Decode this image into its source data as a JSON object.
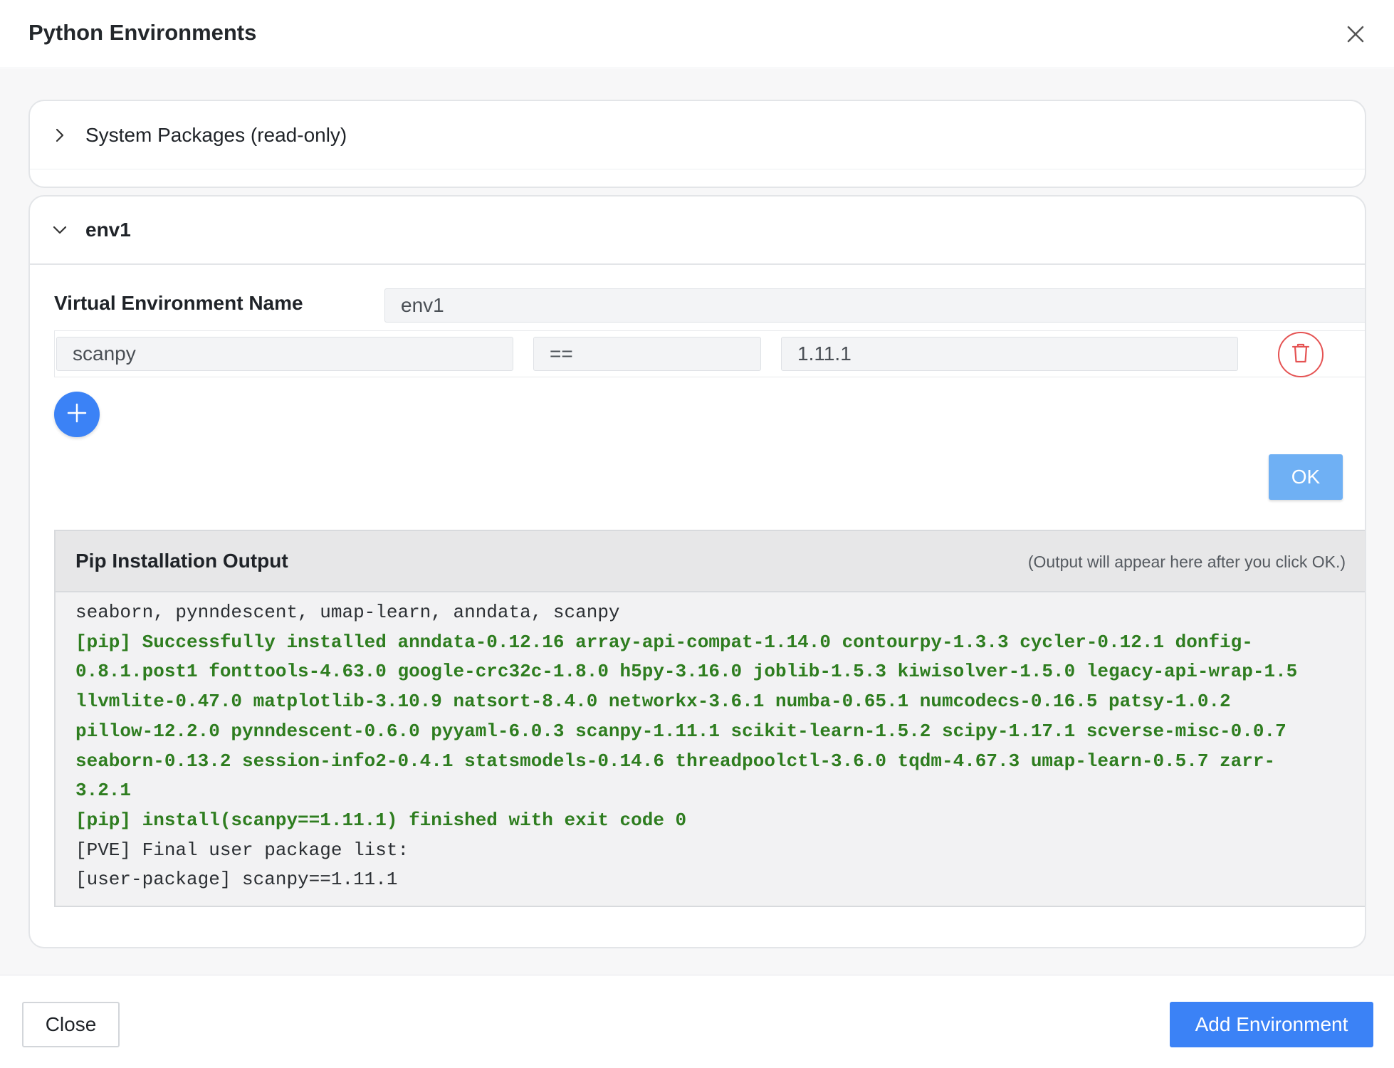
{
  "dialog": {
    "title": "Python Environments"
  },
  "panels": {
    "system": {
      "title": "System Packages (read-only)"
    },
    "env": {
      "title": "env1",
      "name_label": "Virtual Environment Name",
      "name_value": "env1",
      "package": {
        "name": "scanpy",
        "operator": "==",
        "version": "1.11.1"
      },
      "ok_label": "OK"
    }
  },
  "output": {
    "title": "Pip Installation Output",
    "hint": "(Output will appear here after you click OK.)",
    "lines": [
      {
        "text": "seaborn, pynndescent, umap-learn, anndata, scanpy",
        "status": "normal"
      },
      {
        "text": "[pip] Successfully installed anndata-0.12.16 array-api-compat-1.14.0 contourpy-1.3.3 cycler-0.12.1 donfig-",
        "status": "success"
      },
      {
        "text": "0.8.1.post1 fonttools-4.63.0 google-crc32c-1.8.0 h5py-3.16.0 joblib-1.5.3 kiwisolver-1.5.0 legacy-api-wrap-1.5",
        "status": "success"
      },
      {
        "text": "llvmlite-0.47.0 matplotlib-3.10.9 natsort-8.4.0 networkx-3.6.1 numba-0.65.1 numcodecs-0.16.5 patsy-1.0.2",
        "status": "success"
      },
      {
        "text": "pillow-12.2.0 pynndescent-0.6.0 pyyaml-6.0.3 scanpy-1.11.1 scikit-learn-1.5.2 scipy-1.17.1 scverse-misc-0.0.7",
        "status": "success"
      },
      {
        "text": "seaborn-0.13.2 session-info2-0.4.1 statsmodels-0.14.6 threadpoolctl-3.6.0 tqdm-4.67.3 umap-learn-0.5.7 zarr-",
        "status": "success"
      },
      {
        "text": "3.2.1",
        "status": "success"
      },
      {
        "text": "[pip] install(scanpy==1.11.1) finished with exit code 0",
        "status": "success"
      },
      {
        "text": "[PVE] Final user package list:",
        "status": "normal"
      },
      {
        "text": "[user-package] scanpy==1.11.1",
        "status": "normal"
      }
    ]
  },
  "footer": {
    "close_label": "Close",
    "add_env_label": "Add Environment"
  },
  "colors": {
    "primary": "#3b82f6",
    "ok_button": "#6fb0f4",
    "danger": "#e55353",
    "success_text": "#2e7d1f"
  },
  "icons": {
    "close": "close-icon",
    "collapsed": "chevron-right-icon",
    "expanded": "chevron-down-icon",
    "delete": "trash-icon",
    "add": "plus-icon"
  }
}
